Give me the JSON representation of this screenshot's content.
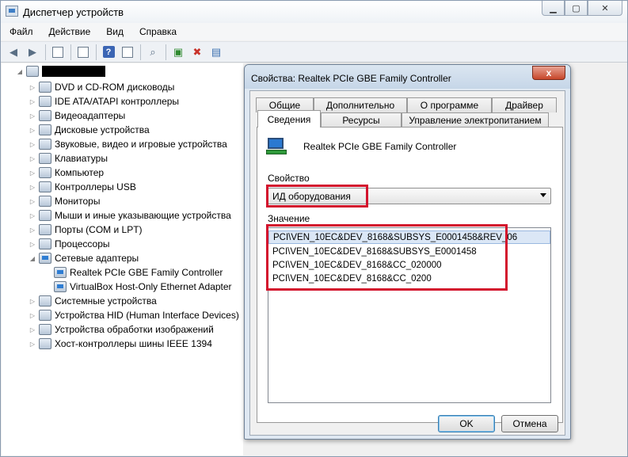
{
  "window": {
    "title": "Диспетчер устройств"
  },
  "menu": [
    "Файл",
    "Действие",
    "Вид",
    "Справка"
  ],
  "toolbar": {
    "icons": [
      "back-arrow-icon",
      "forward-arrow-icon",
      "show-hide-tree-icon",
      "properties-icon",
      "help-icon",
      "view-icon",
      "scan-hardware-icon",
      "update-driver-icon",
      "disable-device-icon",
      "uninstall-device-icon"
    ]
  },
  "tree": {
    "items": [
      "DVD и CD-ROM дисководы",
      "IDE ATA/ATAPI контроллеры",
      "Видеоадаптеры",
      "Дисковые устройства",
      "Звуковые, видео и игровые устройства",
      "Клавиатуры",
      "Компьютер",
      "Контроллеры USB",
      "Мониторы",
      "Мыши и иные указывающие устройства",
      "Порты (COM и LPT)",
      "Процессоры",
      "Сетевые адаптеры",
      "Realtek PCIe GBE Family Controller",
      "VirtualBox Host-Only Ethernet Adapter",
      "Системные устройства",
      "Устройства HID (Human Interface Devices)",
      "Устройства обработки изображений",
      "Хост-контроллеры шины IEEE 1394"
    ]
  },
  "dialog": {
    "title": "Свойства: Realtek PCIe GBE Family Controller",
    "close_label": "x",
    "tabs_row1": [
      "Общие",
      "Дополнительно",
      "О программе",
      "Драйвер"
    ],
    "tabs_row2": [
      "Сведения",
      "Ресурсы",
      "Управление электропитанием"
    ],
    "active_tab": "Сведения",
    "device_name": "Realtek PCIe GBE Family Controller",
    "property_label": "Свойство",
    "property_value": "ИД оборудования",
    "values_label": "Значение",
    "values": [
      "PCI\\VEN_10EC&DEV_8168&SUBSYS_E0001458&REV_06",
      "PCI\\VEN_10EC&DEV_8168&SUBSYS_E0001458",
      "PCI\\VEN_10EC&DEV_8168&CC_020000",
      "PCI\\VEN_10EC&DEV_8168&CC_0200"
    ],
    "ok_label": "OK",
    "cancel_label": "Отмена"
  },
  "colors": {
    "highlight": "#d3132d",
    "selection": "#dbe7f6"
  }
}
